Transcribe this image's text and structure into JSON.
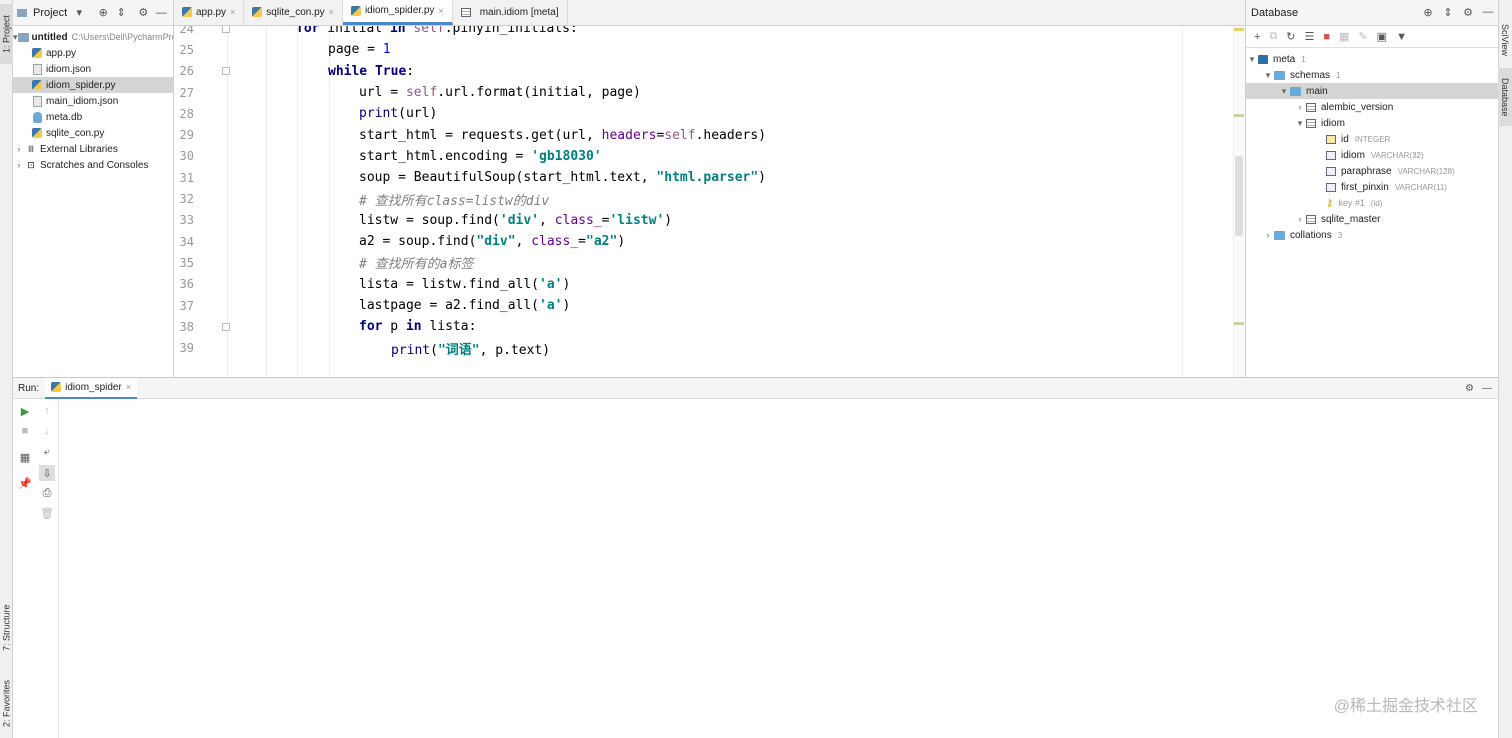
{
  "side_tabs": {
    "project": "1: Project",
    "structure": "7: Structure",
    "favorites": "2: Favorites",
    "sciview": "SciView",
    "database": "Database"
  },
  "project": {
    "title": "Project",
    "root": {
      "name": "untitled",
      "path": "C:\\Users\\Dell\\PycharmProjects\\untitled"
    },
    "files": [
      {
        "name": "app.py",
        "type": "py"
      },
      {
        "name": "idiom.json",
        "type": "json"
      },
      {
        "name": "idiom_spider.py",
        "type": "py",
        "selected": true
      },
      {
        "name": "main_idiom.json",
        "type": "json"
      },
      {
        "name": "meta.db",
        "type": "db"
      },
      {
        "name": "sqlite_con.py",
        "type": "py"
      }
    ],
    "external_libraries": "External Libraries",
    "scratches": "Scratches and Consoles"
  },
  "tabs": [
    {
      "label": "app.py",
      "active": false
    },
    {
      "label": "sqlite_con.py",
      "active": false
    },
    {
      "label": "idiom_spider.py",
      "active": true
    },
    {
      "label": "main.idiom [meta]",
      "active": false
    }
  ],
  "code_lines": [
    24,
    25,
    26,
    27,
    28,
    29,
    30,
    31,
    32,
    33,
    34,
    35,
    36,
    37,
    38,
    39
  ],
  "database": {
    "title": "Database",
    "tree": {
      "meta": "meta",
      "meta_count": "1",
      "schemas": "schemas",
      "schemas_count": "1",
      "main": "main",
      "alembic_version": "alembic_version",
      "idiom": "idiom",
      "columns": [
        {
          "name": "id",
          "type": "INTEGER"
        },
        {
          "name": "idiom",
          "type": "VARCHAR(32)"
        },
        {
          "name": "paraphrase",
          "type": "VARCHAR(128)"
        },
        {
          "name": "first_pinxin",
          "type": "VARCHAR(11)"
        }
      ],
      "key": "key #1",
      "key_cols": "(id)",
      "sqlite_master": "sqlite_master",
      "collations": "collations",
      "collations_count": "3"
    }
  },
  "run": {
    "label": "Run:",
    "tab": "idiom_spider"
  },
  "watermark": "@稀土掘金技术社区"
}
